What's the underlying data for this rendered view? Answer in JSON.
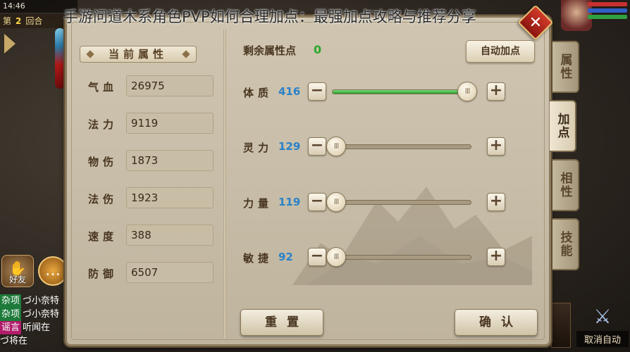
{
  "headline": "手游问道木系角色PVP如何合理加点：最强加点攻略与推荐分享",
  "status": {
    "time": "14:46"
  },
  "round": {
    "prefix": "第",
    "number": "2",
    "suffix": "回合"
  },
  "panel": {
    "current_attrs_title": "当前属性",
    "stats": [
      {
        "label": "气血",
        "value": "26975"
      },
      {
        "label": "法力",
        "value": "9119"
      },
      {
        "label": "物伤",
        "value": "1873"
      },
      {
        "label": "法伤",
        "value": "1923"
      },
      {
        "label": "速度",
        "value": "388"
      },
      {
        "label": "防御",
        "value": "6507"
      }
    ],
    "remaining_label": "剩余属性点",
    "remaining_value": "0",
    "auto_button": "自动加点",
    "attributes": [
      {
        "name": "体质",
        "value": "416",
        "fill": 0.97
      },
      {
        "name": "灵力",
        "value": "129",
        "fill": 0.03
      },
      {
        "name": "力量",
        "value": "119",
        "fill": 0.03
      },
      {
        "name": "敏捷",
        "value": "92",
        "fill": 0.03
      }
    ],
    "minus_symbol": "−",
    "plus_symbol": "+",
    "thumb_grip": "III",
    "reset_button": "重置",
    "confirm_button": "确认",
    "close_symbol": "✕"
  },
  "side_tabs": [
    {
      "label": "属性",
      "active": false
    },
    {
      "label": "加点",
      "active": true
    },
    {
      "label": "相性",
      "active": false
    },
    {
      "label": "技能",
      "active": false
    }
  ],
  "friends_label": "好友",
  "chat": [
    {
      "tag": "杂项",
      "tag_color": "#1e7a3a",
      "text": "づ小奈特"
    },
    {
      "tag": "杂项",
      "tag_color": "#1e7a3a",
      "text": "づ小奈特"
    },
    {
      "tag": "谣言",
      "tag_color": "#b01c6a",
      "text": "听闻在"
    },
    {
      "tag": "",
      "tag_color": "#1e7a3a",
      "text": "づ将在"
    }
  ],
  "cancel_auto_label": "取消自动",
  "colors": {
    "accent_green": "#2aa82a",
    "value_blue": "#2a82c8",
    "close_red": "#c02a1c"
  }
}
